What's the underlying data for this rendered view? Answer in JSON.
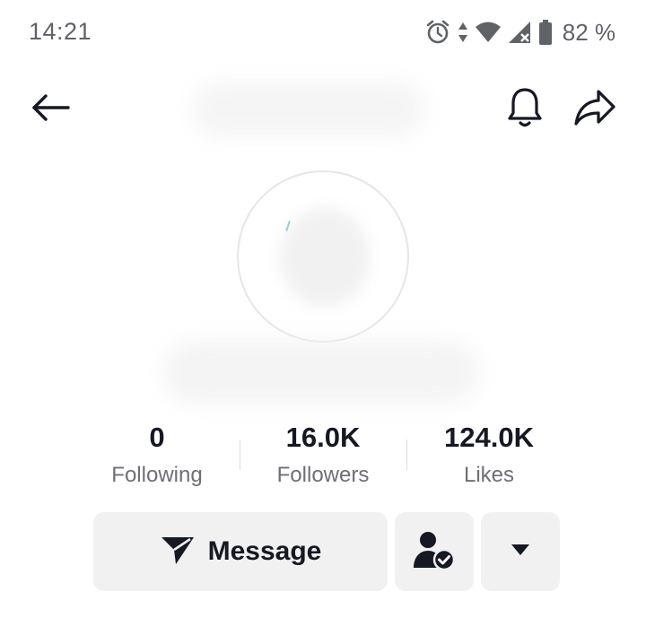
{
  "status_bar": {
    "time": "14:21",
    "battery_percent": "82 %",
    "icons": [
      "alarm-icon",
      "data-transfer-icon",
      "wifi-icon",
      "cell-signal-no-service-icon",
      "battery-icon"
    ]
  },
  "nav": {
    "icons": [
      "back-arrow-icon",
      "bell-icon",
      "share-icon"
    ]
  },
  "profile": {
    "stats": [
      {
        "value": "0",
        "label": "Following"
      },
      {
        "value": "16.0K",
        "label": "Followers"
      },
      {
        "value": "124.0K",
        "label": "Likes"
      }
    ]
  },
  "actions": {
    "message_label": "Message",
    "icons": [
      "paper-plane-icon",
      "friend-check-icon",
      "caret-down-icon"
    ]
  },
  "colors": {
    "text_primary": "#161823",
    "text_secondary": "#6e6f76",
    "button_bg": "#f1f1f2",
    "status_gray": "#5f6368"
  }
}
